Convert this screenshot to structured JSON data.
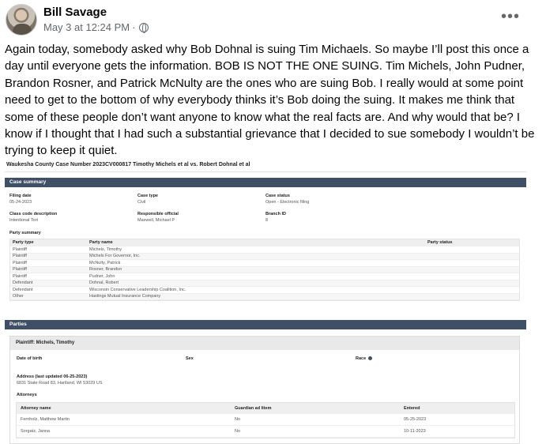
{
  "post": {
    "author": "Bill Savage",
    "timestamp": "May 3 at 12:24 PM",
    "meta_separator": "·",
    "privacy_icon": "globe-icon",
    "more_label": "•••",
    "text": "Again today, somebody asked why Bob Dohnal is suing Tim Michaels. So maybe I’ll post this once a day until everyone gets the information. BOB IS NOT THE ONE SUING. Tim Michels, John Pudner, Brandon Rosner, and Patrick McNulty are the ones who are suing Bob. I really would at some point need to get to the bottom of why everybody thinks it’s Bob doing the suing. It makes me think that some of these people don’t want anyone to know what the real facts are.  And why would that be? I know if I thought that I had such a substantial grievance that I decided to sue somebody I wouldn’t be trying to keep it quiet."
  },
  "document": {
    "title": "Waukesha County Case Number 2023CV000817 Timothy Michels et al vs. Robert Dohnal et al",
    "case_summary": {
      "heading": "Case summary",
      "filing_date_label": "Filing date",
      "filing_date": "05-24-2023",
      "case_type_label": "Case type",
      "case_type": "Civil",
      "case_status_label": "Case status",
      "case_status": "Open - Electronic filing",
      "class_code_label": "Class code description",
      "class_code": "Intentional Tort",
      "responsible_official_label": "Responsible official",
      "responsible_official": "Maxwell, Michael P",
      "branch_id_label": "Branch ID",
      "branch_id": "8",
      "party_summary_label": "Party summary",
      "party_headers": [
        "Party type",
        "Party name",
        "Party status"
      ],
      "parties": [
        {
          "type": "Plaintiff",
          "name": "Michels, Timothy",
          "status": ""
        },
        {
          "type": "Plaintiff",
          "name": "Michels For Governor, Inc.",
          "status": ""
        },
        {
          "type": "Plaintiff",
          "name": "McNulty, Patrick",
          "status": ""
        },
        {
          "type": "Plaintiff",
          "name": "Rosner, Brandon",
          "status": ""
        },
        {
          "type": "Plaintiff",
          "name": "Pudner, John",
          "status": ""
        },
        {
          "type": "Defendant",
          "name": "Dohnal, Robert",
          "status": ""
        },
        {
          "type": "Defendant",
          "name": "Wisconsin Conservative Leadership Coalition, Inc.",
          "status": ""
        },
        {
          "type": "Other",
          "name": "Hastings Mutual Insurance Company",
          "status": ""
        }
      ]
    },
    "parties_section": {
      "heading": "Parties",
      "plaintiff_heading": "Plaintiff: Michels, Timothy",
      "dob_label": "Date of birth",
      "sex_label": "Sex",
      "race_label": "Race",
      "address_label": "Address (last updated 06-25-2023)",
      "address": "6831 State Road 83, Hartland, WI 53029 US",
      "attorneys_label": "Attorneys",
      "attorney_headers": [
        "Attorney name",
        "Guardian ad litem",
        "Entered"
      ],
      "attorneys": [
        {
          "name": "Fernholz, Matthew Martin",
          "gal": "No",
          "entered": "05-25-2023"
        },
        {
          "name": "Sorgatz, Janna",
          "gal": "No",
          "entered": "10-11-2023"
        }
      ]
    }
  }
}
